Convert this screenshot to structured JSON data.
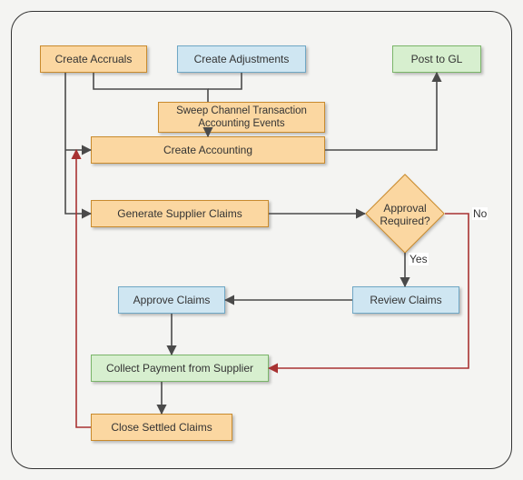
{
  "nodes": {
    "create_accruals": "Create Accruals",
    "create_adjustments": "Create Adjustments",
    "post_to_gl": "Post to GL",
    "sweep_events": "Sweep Channel Transaction Accounting Events",
    "create_accounting": "Create Accounting",
    "generate_claims": "Generate Supplier Claims",
    "approval_required": "Approval Required?",
    "review_claims": "Review Claims",
    "approve_claims": "Approve Claims",
    "collect_payment": "Collect Payment from Supplier",
    "close_claims": "Close Settled Claims"
  },
  "edge_labels": {
    "yes": "Yes",
    "no": "No"
  },
  "colors": {
    "orange": "#fbd7a1",
    "blue": "#cfe6f2",
    "green": "#d7efcf",
    "edge_dark": "#4a4a4a",
    "edge_red": "#a83232"
  }
}
